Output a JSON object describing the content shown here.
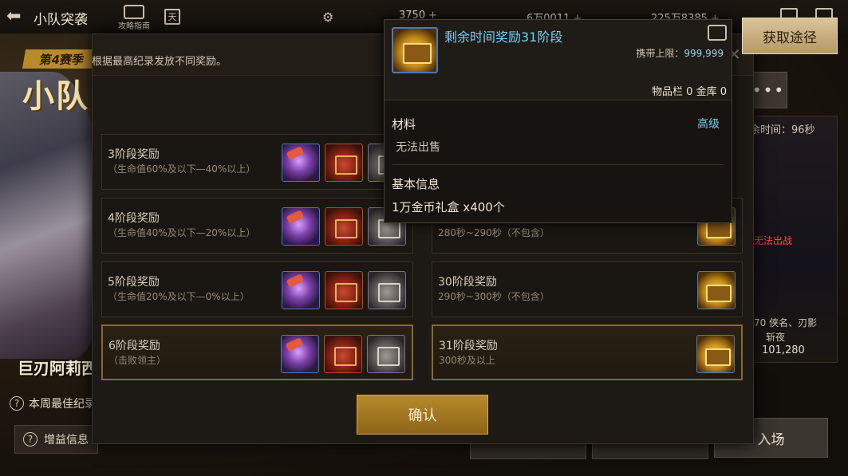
{
  "topbar": {
    "title": "小队突袭",
    "guide_label": "攻略指南",
    "calendar_glyph": "天",
    "currency": [
      {
        "value": "3750",
        "plus": "+"
      },
      {
        "value": "6万0011",
        "plus": "+"
      },
      {
        "value": "225万8385",
        "plus": "+"
      }
    ]
  },
  "background": {
    "season_badge": "第4赛季",
    "banner_title": "小队",
    "char_name": "巨刃阿莉西",
    "week_best": "本周最佳纪录",
    "buff_info": "增益信息",
    "remaining_time": "余时间：96秒",
    "cannot_attack": "无法出战",
    "stats_line1": "70 侠名、刃影",
    "stats_line2": "斩夜",
    "stats_line3": "101,280",
    "enter": "入场",
    "more": "•••"
  },
  "dialog": {
    "subtitle": "根据最高纪录发放不同奖励。",
    "left_rows": [
      {
        "name": "3阶段奖励",
        "cond": "（生命值60%及以下—40%以上）"
      },
      {
        "name": "4阶段奖励",
        "cond": "（生命值40%及以下—20%以上）"
      },
      {
        "name": "5阶段奖励",
        "cond": "（生命值20%及以下—0%以上）"
      },
      {
        "name": "6阶段奖励",
        "cond": "（击败领主）"
      }
    ],
    "right_rows": [
      {
        "name": "",
        "cond": "280秒~290秒（不包含）"
      },
      {
        "name": "30阶段奖励",
        "cond": "290秒~300秒（不包含）"
      },
      {
        "name": "31阶段奖励",
        "cond": "300秒及以上"
      }
    ],
    "confirm": "确认"
  },
  "tooltip": {
    "title": "剩余时间奖励31阶段",
    "limit_label": "携带上限：",
    "limit_value": "999,999",
    "storage": "物品栏 0 金库 0",
    "category": "材料",
    "grade": "高级",
    "tradability": "无法出售",
    "basic_info": "基本信息",
    "description": "1万金币礼盒 x400个"
  },
  "acquire_button": "获取途径"
}
